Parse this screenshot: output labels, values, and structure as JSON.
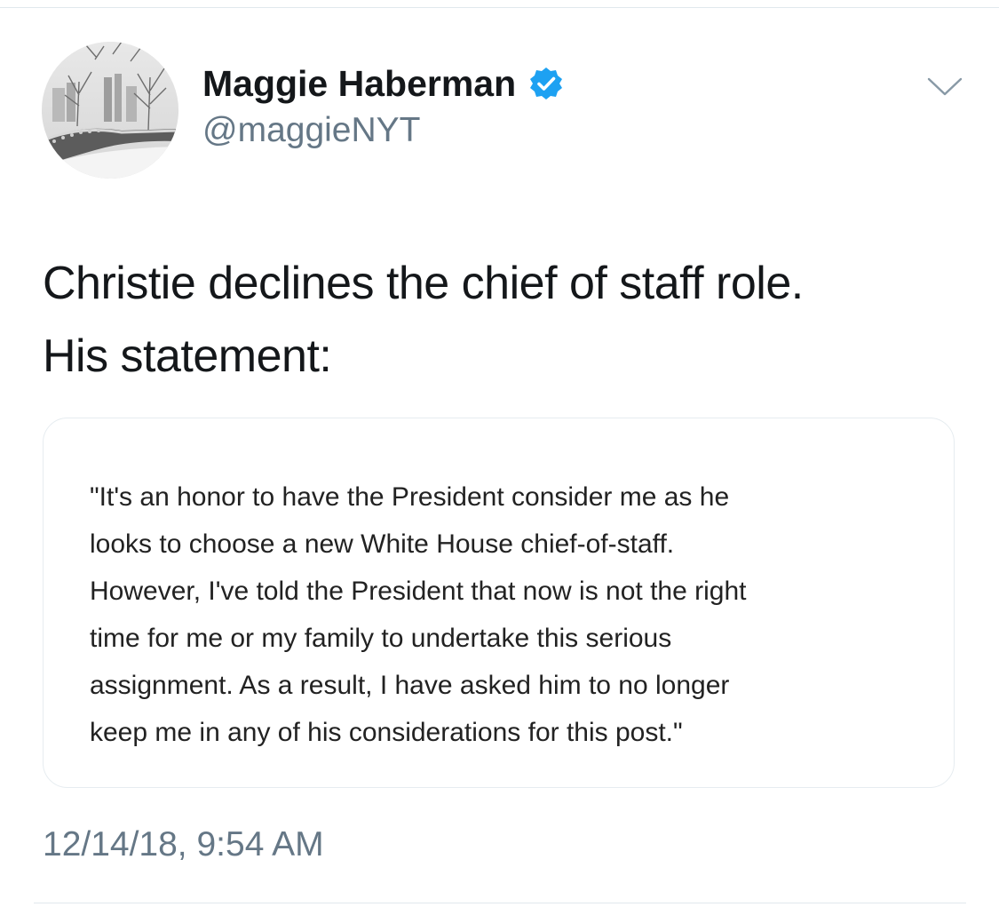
{
  "author": {
    "display_name": "Maggie Haberman",
    "handle": "@maggieNYT",
    "verified": true,
    "avatar": "snowy-central-park-bridge-photo"
  },
  "menu_icon": "chevron-down-icon",
  "tweet": {
    "text_lines": [
      "Christie declines the chief of staff role.",
      "His statement:"
    ],
    "media_statement_lines": [
      "\"It's an honor to have the President consider me as he",
      "looks to choose a new White House chief-of-staff.",
      "However, I've told the President that now is not the right",
      "time for me or my family to undertake this serious",
      "assignment. As a result, I have asked him to no longer",
      "keep me in any of his considerations for this post.\""
    ],
    "timestamp": "12/14/18, 9:54 AM"
  },
  "colors": {
    "text": "#14171a",
    "secondary": "#657786",
    "verified_badge": "#1da1f2",
    "divider": "#e1e8ed"
  }
}
